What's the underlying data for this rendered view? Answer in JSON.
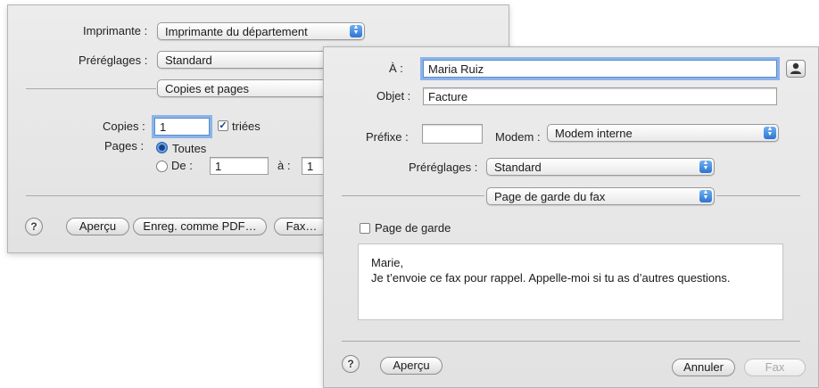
{
  "print_dialog": {
    "printer_label": "Imprimante :",
    "printer_value": "Imprimante du département",
    "presets_label": "Préréglages :",
    "presets_value": "Standard",
    "section_value": "Copies et pages",
    "copies_label": "Copies :",
    "copies_value": "1",
    "collated_label": "triées",
    "pages_label": "Pages :",
    "all_label": "Toutes",
    "from_label": "De :",
    "from_value": "1",
    "to_label": "à :",
    "to_value": "1",
    "preview_button": "Aperçu",
    "save_pdf_button": "Enreg. comme PDF…",
    "fax_button": "Fax…",
    "help_label": "?"
  },
  "fax_dialog": {
    "to_label": "À :",
    "to_value": "Maria Ruiz",
    "subject_label": "Objet :",
    "subject_value": "Facture",
    "prefix_label": "Préfixe :",
    "prefix_value": "",
    "modem_label": "Modem :",
    "modem_value": "Modem interne",
    "presets_label": "Préréglages :",
    "presets_value": "Standard",
    "section_value": "Page de garde du fax",
    "cover_page_label": "Page de garde",
    "message_line1": "Marie,",
    "message_line2": "Je t’envoie ce fax pour rappel. Appelle-moi si tu as d’autres questions.",
    "preview_button": "Aperçu",
    "cancel_button": "Annuler",
    "fax_button": "Fax",
    "help_label": "?"
  },
  "icons": {
    "popup_arrow": "up-down-arrows-icon",
    "address_book": "person-icon"
  }
}
